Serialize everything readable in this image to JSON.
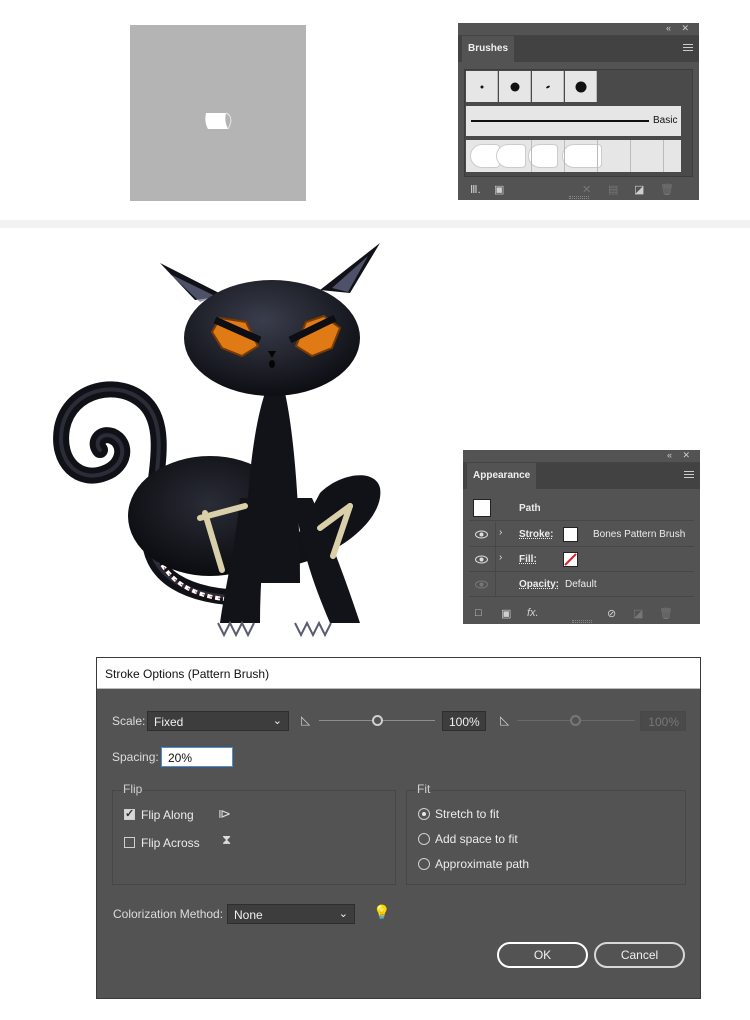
{
  "brushes_panel": {
    "tab": "Brushes",
    "basic_label": "Basic",
    "footer_icons": [
      "brush-libraries-icon",
      "libraries-panel-icon",
      "remove-stroke-icon",
      "options-icon",
      "new-brush-icon",
      "delete-icon"
    ]
  },
  "appearance_panel": {
    "tab": "Appearance",
    "header": "Path",
    "rows": [
      {
        "label": "Stroke:",
        "value": "Bones Pattern Brush"
      },
      {
        "label": "Fill:",
        "value": ""
      },
      {
        "label": "Opacity:",
        "value": "Default"
      }
    ],
    "footer_icons": [
      "add-stroke-icon",
      "add-fill-icon",
      "fx-icon",
      "clear-icon",
      "duplicate-icon",
      "delete-icon"
    ],
    "fx_label": "fx."
  },
  "dialog": {
    "title": "Stroke Options (Pattern Brush)",
    "scale_label": "Scale:",
    "scale_value": "Fixed",
    "scale_percent": "100%",
    "scale_percent_max": "100%",
    "spacing_label": "Spacing:",
    "spacing_value": "20%",
    "flip_title": "Flip",
    "flip_along_label": "Flip Along",
    "flip_along_checked": true,
    "flip_across_label": "Flip Across",
    "flip_across_checked": false,
    "fit_title": "Fit",
    "fit_options": [
      "Stretch to fit",
      "Add space to fit",
      "Approximate path"
    ],
    "fit_selected": "Stretch to fit",
    "colorization_label": "Colorization Method:",
    "colorization_value": "None",
    "ok_label": "OK",
    "cancel_label": "Cancel"
  },
  "colors": {
    "panel_bg": "#535353",
    "artboard": "#b4b4b4",
    "cat_eye": "#e07a14",
    "cat_body": "#15161c"
  }
}
